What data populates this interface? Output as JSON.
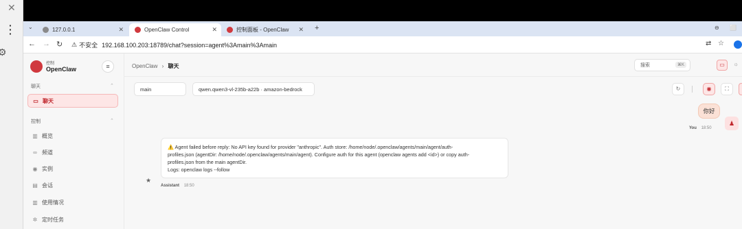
{
  "browser": {
    "tabs": [
      {
        "label": "127.0.0.1",
        "icon": "globe-icon",
        "active": false
      },
      {
        "label": "OpenClaw Control",
        "icon": "openclaw-icon",
        "active": true
      },
      {
        "label": "控制面板 - OpenClaw",
        "icon": "openclaw-icon",
        "active": false
      }
    ],
    "security_label": "不安全",
    "url": "192.168.100.203:18789/chat?session=agent%3Amain%3Amain"
  },
  "sidebar": {
    "brand_sub": "控制",
    "brand": "OpenClaw",
    "sections": [
      {
        "label": "聊天",
        "items": [
          {
            "label": "聊天",
            "icon": "chat-icon",
            "active": true
          }
        ]
      },
      {
        "label": "控制",
        "items": [
          {
            "label": "概览",
            "icon": "bar-chart-icon"
          },
          {
            "label": "频道",
            "icon": "link-icon"
          },
          {
            "label": "实例",
            "icon": "broadcast-icon"
          },
          {
            "label": "会话",
            "icon": "document-icon"
          },
          {
            "label": "使用情况",
            "icon": "bar-chart-icon"
          },
          {
            "label": "定时任务",
            "icon": "loader-icon"
          }
        ]
      }
    ]
  },
  "header": {
    "crumb_root": "OpenClaw",
    "crumb_current": "聊天",
    "search_placeholder": "搜索",
    "search_shortcut": "⌘K"
  },
  "chat": {
    "session": "main",
    "model": "qwen.qwen3-vl-235b-a22b · amazon-bedrock",
    "user_message": "你好",
    "user_name": "You",
    "user_time": "18:50",
    "assistant_message_lines": [
      "⚠️ Agent failed before reply: No API key found for provider \"anthropic\". Auth store: /home/node/.openclaw/agents/main/agent/auth-",
      "profiles.json (agentDir: /home/node/.openclaw/agents/main/agent). Configure auth for this agent (openclaw agents add <id>) or copy auth-",
      "profiles.json from the main agentDir.",
      "Logs: openclaw logs --follow"
    ],
    "assistant_name": "Assistant",
    "assistant_time": "18:50"
  },
  "colors": {
    "accent": "#d0393e",
    "user_bubble": "#fbe1d6"
  }
}
